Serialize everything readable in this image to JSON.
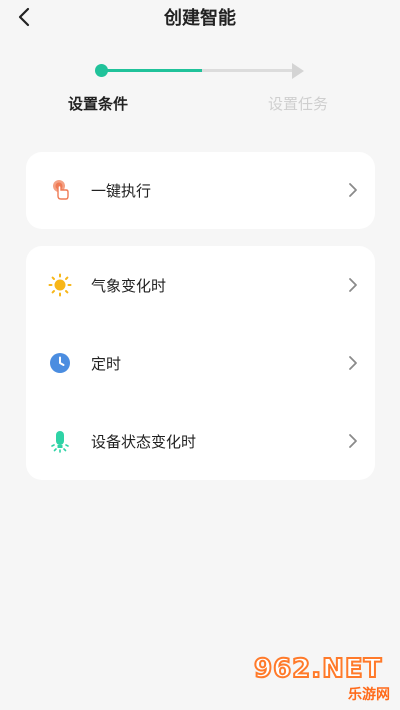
{
  "header": {
    "title": "创建智能",
    "back_icon": "chevron-left-icon"
  },
  "stepper": {
    "steps": [
      {
        "label": "设置条件",
        "active": true
      },
      {
        "label": "设置任务",
        "active": false
      }
    ],
    "active_color": "#20c29a",
    "inactive_color": "#dcdcdc"
  },
  "card_primary": {
    "items": [
      {
        "label": "一键执行",
        "icon": "tap-hand-icon",
        "icon_color": "#ef7b55"
      }
    ]
  },
  "card_conditions": {
    "items": [
      {
        "label": "气象变化时",
        "icon": "sun-icon",
        "icon_color": "#f7b619"
      },
      {
        "label": "定时",
        "icon": "clock-icon",
        "icon_color": "#4b8de0"
      },
      {
        "label": "设备状态变化时",
        "icon": "device-bulb-icon",
        "icon_color": "#2fd3a6"
      }
    ]
  },
  "watermark": {
    "logo": "962.NET",
    "subtitle": "乐游网"
  }
}
